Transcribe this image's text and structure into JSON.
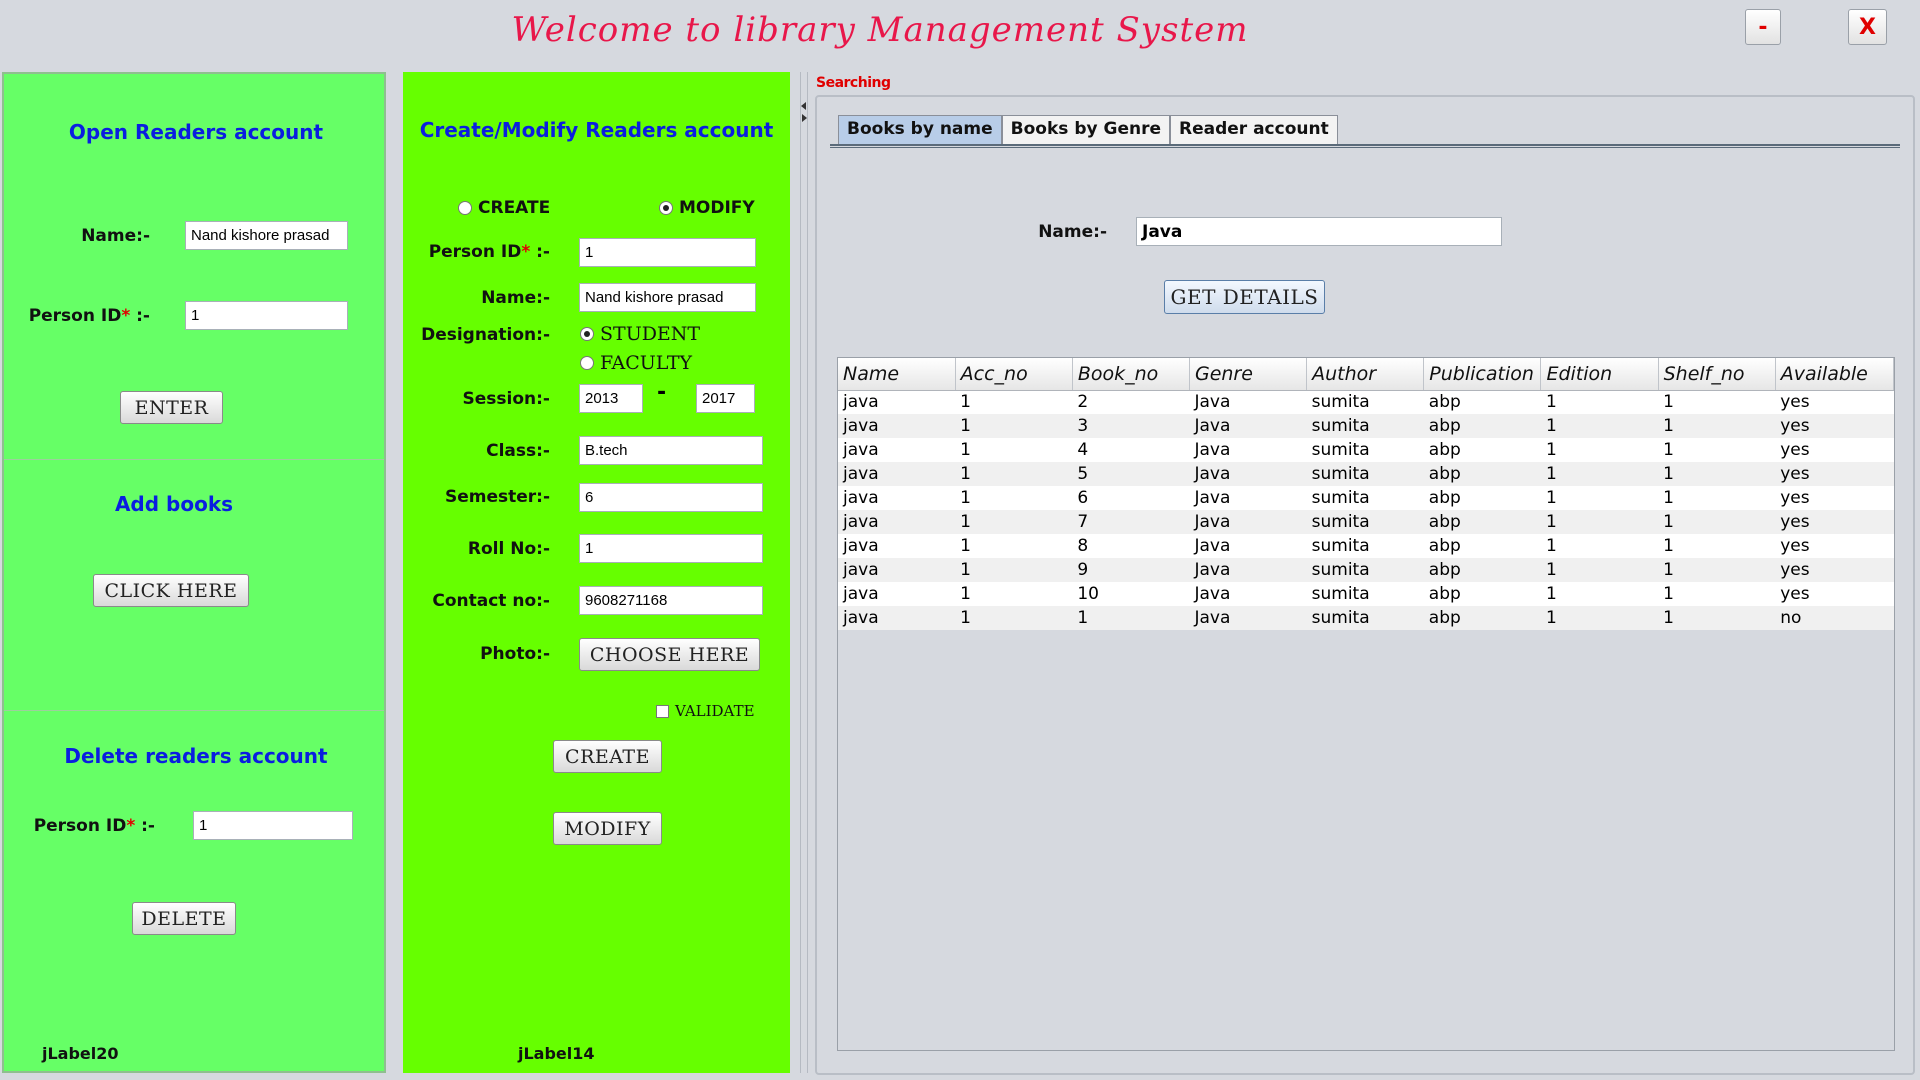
{
  "window": {
    "title": "Welcome to library Management System",
    "minimize_label": "-",
    "close_label": "X"
  },
  "open_account": {
    "heading": "Open Readers account",
    "name_label": "Name:-",
    "name_value": "Nand kishore prasad",
    "person_id_label": "Person ID",
    "required_mark": "*",
    "person_id_suffix": " :-",
    "person_id_value": "1",
    "enter_button": "ENTER"
  },
  "add_books": {
    "heading": "Add books",
    "click_button": "CLICK HERE"
  },
  "delete_account": {
    "heading": "Delete readers account",
    "person_id_label": "Person ID",
    "required_mark": "*",
    "person_id_suffix": " :-",
    "person_id_value": "1",
    "delete_button": "DELETE",
    "footer_label": "jLabel20"
  },
  "modify_account": {
    "heading": "Create/Modify Readers account",
    "create_radio": "CREATE",
    "modify_radio": "MODIFY",
    "person_id_label": "Person ID",
    "required_mark": "*",
    "person_id_suffix": " :-",
    "person_id_value": "1",
    "name_label": "Name:-",
    "name_value": "Nand kishore prasad",
    "designation_label": "Designation:-",
    "student_option": "STUDENT",
    "faculty_option": "FACULTY",
    "session_label": "Session:-",
    "session_from": "2013",
    "session_dash": "-",
    "session_to": "2017",
    "class_label": "Class:-",
    "class_value": "B.tech",
    "semester_label": "Semester:-",
    "semester_value": "6",
    "roll_label": "Roll No:-",
    "roll_value": "1",
    "contact_label": "Contact no:-",
    "contact_value": "9608271168",
    "photo_label": "Photo:-",
    "choose_button": "CHOOSE HERE",
    "validate_label": "VALIDATE",
    "create_button": "CREATE",
    "modify_button": "MODIFY",
    "footer_label": "jLabel14"
  },
  "search": {
    "section_label": "Searching",
    "tabs": [
      "Books by name",
      "Books by Genre",
      "Reader account"
    ],
    "name_label": "Name:-",
    "name_value": "Java",
    "get_details_button": "GET DETAILS",
    "columns": [
      "Name",
      "Acc_no",
      "Book_no",
      "Genre",
      "Author",
      "Publication",
      "Edition",
      "Shelf_no",
      "Available"
    ],
    "rows": [
      [
        "java",
        "1",
        "2",
        "Java",
        "sumita",
        "abp",
        "1",
        "1",
        "yes"
      ],
      [
        "java",
        "1",
        "3",
        "Java",
        "sumita",
        "abp",
        "1",
        "1",
        "yes"
      ],
      [
        "java",
        "1",
        "4",
        "Java",
        "sumita",
        "abp",
        "1",
        "1",
        "yes"
      ],
      [
        "java",
        "1",
        "5",
        "Java",
        "sumita",
        "abp",
        "1",
        "1",
        "yes"
      ],
      [
        "java",
        "1",
        "6",
        "Java",
        "sumita",
        "abp",
        "1",
        "1",
        "yes"
      ],
      [
        "java",
        "1",
        "7",
        "Java",
        "sumita",
        "abp",
        "1",
        "1",
        "yes"
      ],
      [
        "java",
        "1",
        "8",
        "Java",
        "sumita",
        "abp",
        "1",
        "1",
        "yes"
      ],
      [
        "java",
        "1",
        "9",
        "Java",
        "sumita",
        "abp",
        "1",
        "1",
        "yes"
      ],
      [
        "java",
        "1",
        "10",
        "Java",
        "sumita",
        "abp",
        "1",
        "1",
        "yes"
      ],
      [
        "java",
        "1",
        "1",
        "Java",
        "sumita",
        "abp",
        "1",
        "1",
        "no"
      ]
    ]
  }
}
